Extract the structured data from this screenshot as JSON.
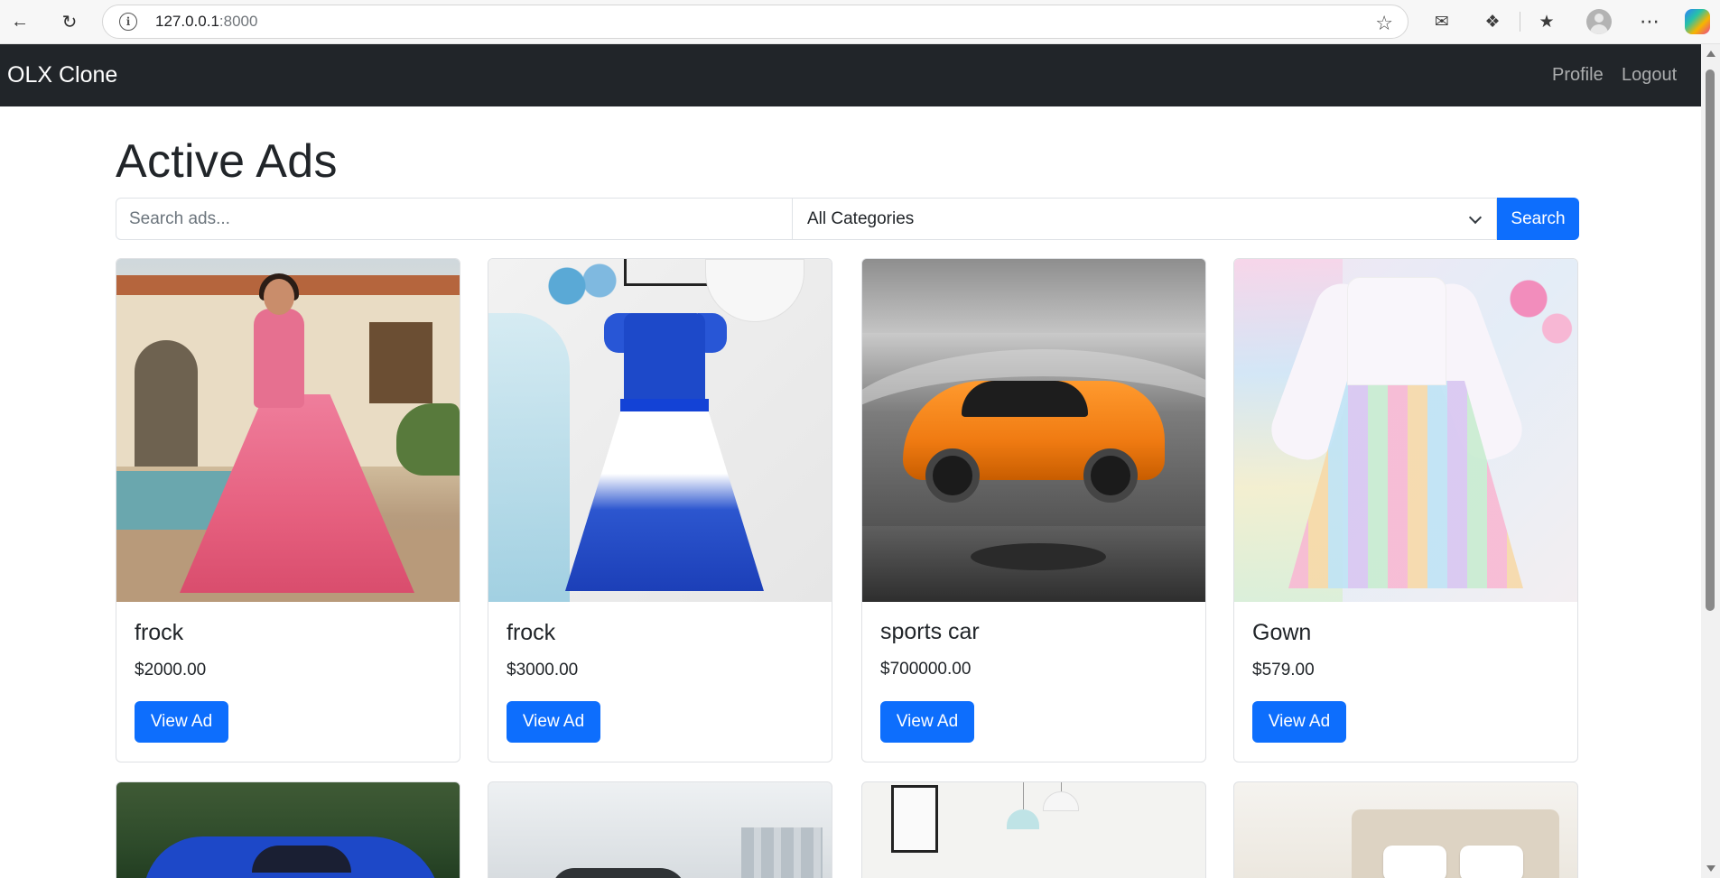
{
  "browser": {
    "address_host": "127.0.0.1",
    "address_port": ":8000"
  },
  "navbar": {
    "brand": "OLX Clone",
    "links": [
      "Profile",
      "Logout"
    ],
    "background": "#212529"
  },
  "page": {
    "title": "Active Ads",
    "search_placeholder": "Search ads...",
    "category_selected": "All Categories",
    "search_button": "Search",
    "accent": "#0d6efd"
  },
  "ads": [
    {
      "title": "frock",
      "price": "$2000.00",
      "button": "View Ad",
      "image": "pink-gown-photo"
    },
    {
      "title": "frock",
      "price": "$3000.00",
      "button": "View Ad",
      "image": "blue-butterfly-dress-photo"
    },
    {
      "title": "sports car",
      "price": "$700000.00",
      "button": "View Ad",
      "image": "orange-sports-car-photo"
    },
    {
      "title": "Gown",
      "price": "$579.00",
      "button": "View Ad",
      "image": "rainbow-gown-photo"
    }
  ],
  "ads_partial_row": [
    {
      "image": "blue-suv-photo"
    },
    {
      "image": "city-car-photo"
    },
    {
      "image": "living-room-photo"
    },
    {
      "image": "bedroom-photo"
    }
  ]
}
